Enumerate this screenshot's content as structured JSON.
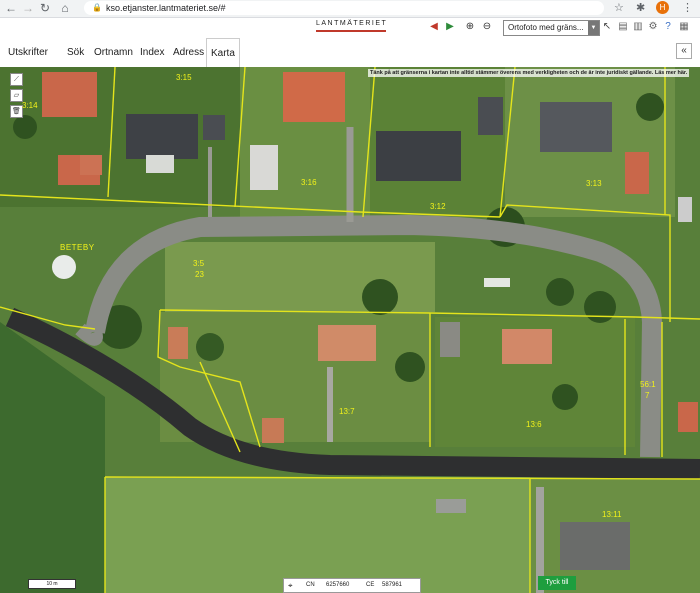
{
  "browser": {
    "url": "kso.etjanster.lantmateriet.se/#",
    "avatar_letter": "H"
  },
  "header": {
    "logo": "LANTMÄTERIET",
    "layer_select": "Ortofoto med gräns..."
  },
  "tabs": [
    {
      "label": "Utskrifter"
    },
    {
      "label": "Sök"
    },
    {
      "label": "Ortnamn"
    },
    {
      "label": "Index"
    },
    {
      "label": "Adress"
    },
    {
      "label": "Karta"
    }
  ],
  "active_tab": "Karta",
  "map": {
    "disclaimer": "Tänk på att gränserna i kartan inte alltid stämmer överens med verkligheten och de är inte juridiskt gällande. Läs mer här.",
    "place_name": "BETEBY",
    "property_labels": [
      "3:14",
      "3:15",
      "3:16",
      "3:12",
      "3:13",
      "3:5",
      "23",
      "13:7",
      "13:6",
      "56:1",
      "7",
      "13:11"
    ],
    "scale": "10 m",
    "coords": {
      "n_label": "CN",
      "n_value": "6257660",
      "e_label": "CE",
      "e_value": "587961"
    },
    "feedback_button": "Tyck till"
  }
}
